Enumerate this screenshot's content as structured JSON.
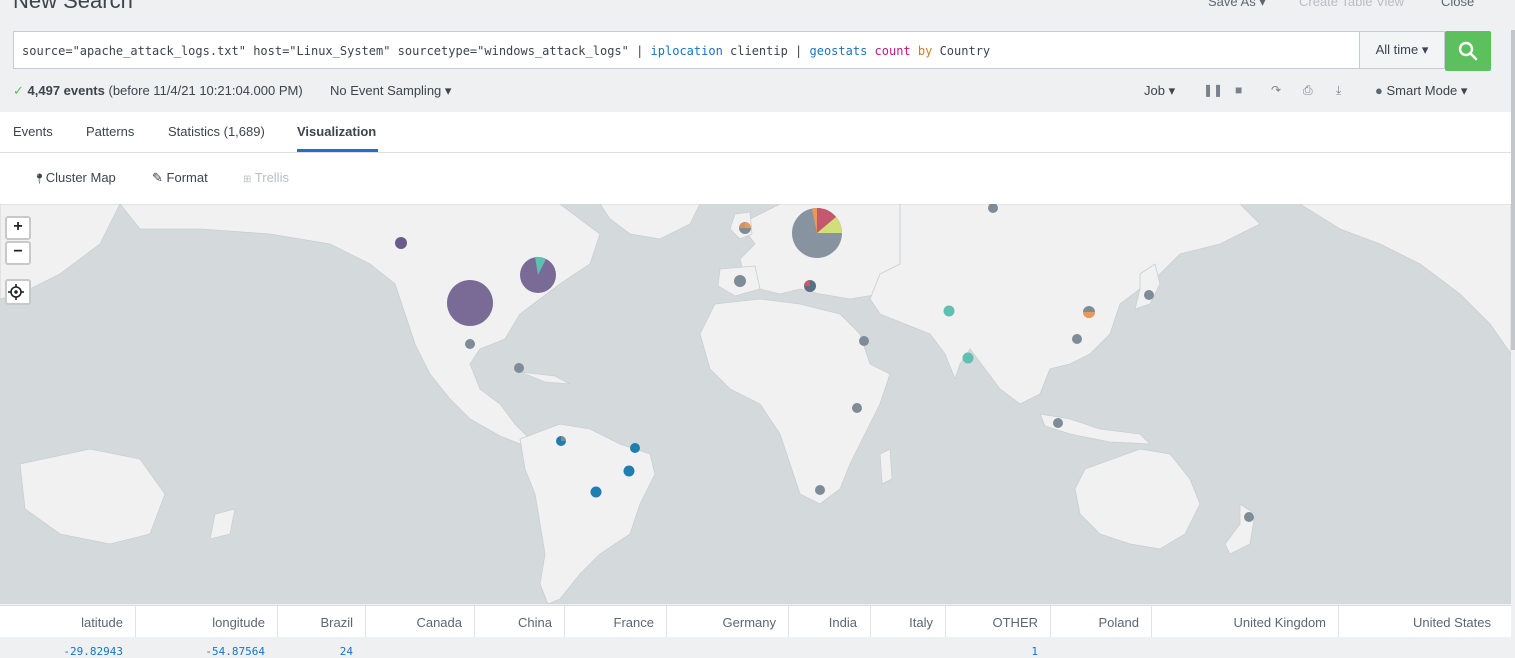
{
  "page": {
    "title": "New Search",
    "actions": [
      "Save As ▾",
      "Create Table View",
      "Close"
    ]
  },
  "search": {
    "query_parts": [
      {
        "text": "source=\"apache_attack_logs.txt\" host=\"Linux_System\" sourcetype=\"windows_attack_logs\" | ",
        "style": "plain"
      },
      {
        "text": "iplocation",
        "style": "blue"
      },
      {
        "text": " clientip | ",
        "style": "plain"
      },
      {
        "text": "geostats",
        "style": "blue"
      },
      {
        "text": " ",
        "style": "plain"
      },
      {
        "text": "count",
        "style": "pink"
      },
      {
        "text": " ",
        "style": "plain"
      },
      {
        "text": "by",
        "style": "orange"
      },
      {
        "text": " Country",
        "style": "plain"
      }
    ],
    "time_range": "All time ▾"
  },
  "status": {
    "count": "4,497 events",
    "detail": "(before 11/4/21 10:21:04.000 PM)",
    "sampling": "No Event Sampling ▾",
    "job": "Job ▾",
    "mode": "Smart Mode ▾"
  },
  "tabs": [
    "Events",
    "Patterns",
    "Statistics (1,689)",
    "Visualization"
  ],
  "viz_toolbar": {
    "cluster_map": "Cluster Map",
    "format": "Format",
    "trellis": "Trellis"
  },
  "map": {
    "zoom_in": "+",
    "zoom_out": "−",
    "colors": {
      "ocean": "#d4dadc",
      "land": "#f1f1f1",
      "purple": "#6b5b8c",
      "gray": "#7e8c98",
      "teal": "#5fbfb0",
      "blue": "#1f7db0",
      "orange": "#e89a5a",
      "red": "#c4586c",
      "yellow": "#d3dd7a"
    }
  },
  "table": {
    "headers": [
      "latitude",
      "longitude",
      "Brazil",
      "Canada",
      "China",
      "France",
      "Germany",
      "India",
      "Italy",
      "OTHER",
      "Poland",
      "United Kingdom",
      "United States"
    ],
    "row": [
      "-29.82943",
      "-54.87564",
      "24",
      "",
      "",
      "",
      "",
      "",
      "",
      "1",
      "",
      "",
      ""
    ]
  }
}
